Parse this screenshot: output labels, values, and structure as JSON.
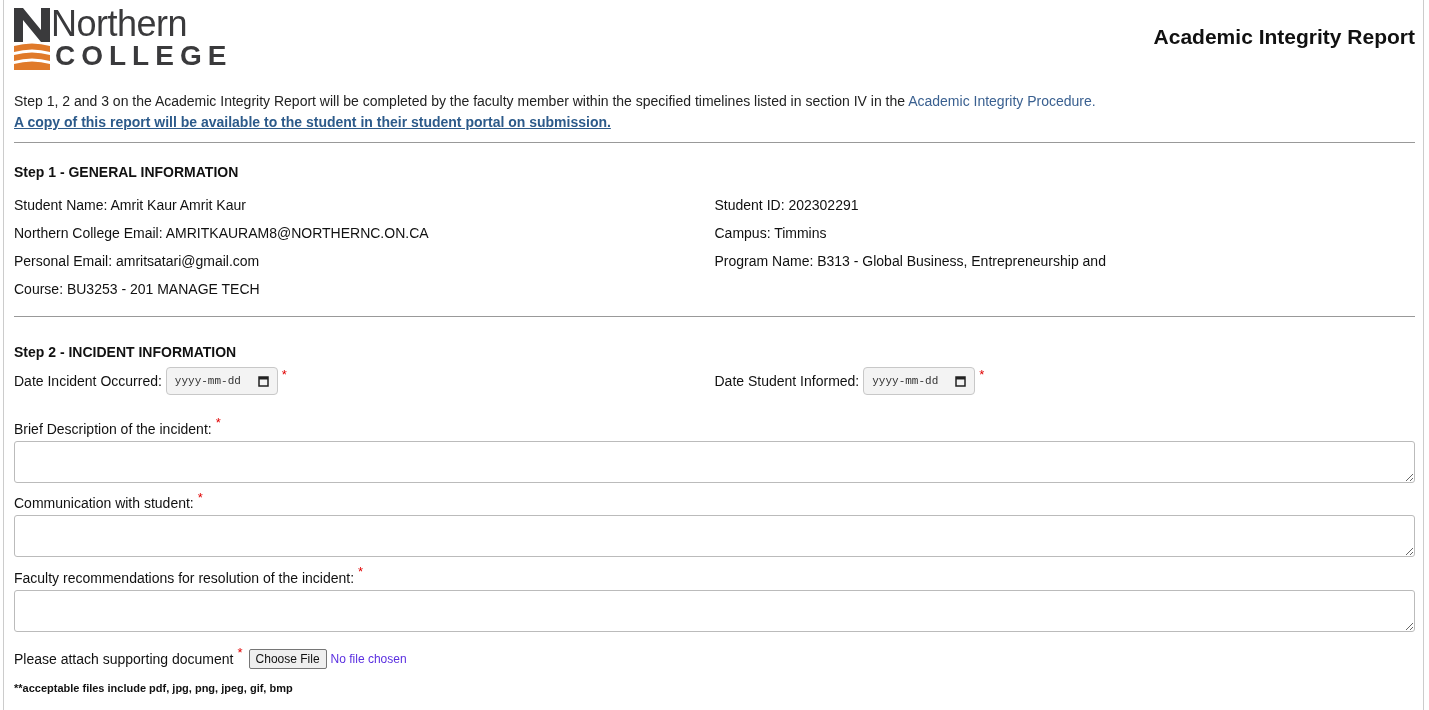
{
  "header": {
    "logo": {
      "word_top": "Northern",
      "word_bottom": "COLLEGE"
    },
    "title": "Academic Integrity Report"
  },
  "intro": {
    "text": "Step 1, 2 and 3 on the Academic Integrity Report will be completed by the faculty member within the specified timelines listed in section IV in the",
    "procedure_link": "Academic Integrity Procedure.",
    "copy_link": "A copy of this report will be available to the student in their student portal on submission."
  },
  "step1": {
    "heading": "Step 1 - GENERAL INFORMATION",
    "left": [
      "Student Name: Amrit Kaur Amrit Kaur",
      "Northern College Email: AMRITKAURAM8@NORTHERNC.ON.CA",
      "Personal Email: amritsatari@gmail.com",
      "Course: BU3253 - 201 MANAGE TECH"
    ],
    "right": [
      "Student ID: 202302291",
      "Campus: Timmins",
      "Program Name: B313 - Global Business, Entrepreneurship and"
    ]
  },
  "step2": {
    "heading": "Step 2 - INCIDENT INFORMATION",
    "dates": [
      {
        "label": "Date Incident Occurred:",
        "placeholder": "yyyy-mm-dd",
        "required_mark": "*"
      },
      {
        "label": "Date Student Informed:",
        "placeholder": "yyyy-mm-dd",
        "required_mark": "*"
      }
    ],
    "textareas": [
      {
        "label": "Brief Description of the incident:",
        "required_mark": "*"
      },
      {
        "label": "Communication with student:",
        "required_mark": "*"
      },
      {
        "label": "Faculty recommendations for resolution of the incident:",
        "required_mark": "*"
      }
    ],
    "attachment": {
      "label": "Please attach supporting document",
      "required_mark": "*",
      "button": "Choose File",
      "status": "No file chosen",
      "note": "**acceptable files include pdf, jpg, png, jpeg, gif, bmp"
    }
  }
}
